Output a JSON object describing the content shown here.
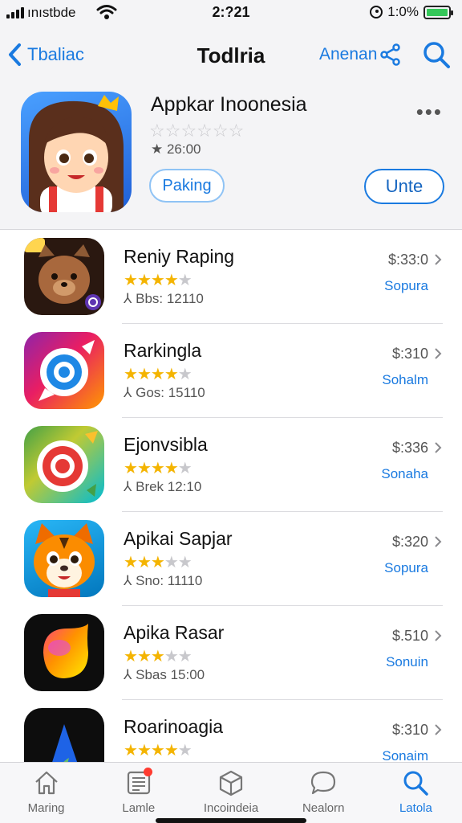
{
  "status_bar": {
    "carrier": "ınıstbde",
    "time": "2:?21",
    "battery": "1:0%",
    "battery_level": 1.0
  },
  "nav": {
    "back_label": "Tbaliac",
    "title": "Todlria",
    "share_label": "Anenan"
  },
  "featured": {
    "title": "Appkar Inoonesia",
    "rating_stars": "☆☆☆☆☆☆",
    "rating_count": "★ 26:00",
    "secondary_button": "Paking",
    "primary_button": "Unte",
    "more_label": "•••"
  },
  "apps": [
    {
      "name": "Reniy Raping",
      "rating": 4,
      "meta": "⅄ Bbs: 12110",
      "price": "$:33:0",
      "action": "Sopura",
      "icon": "bear-face-icon"
    },
    {
      "name": "Rarkingla",
      "rating": 4,
      "meta": "⅄ Gos: 15110",
      "price": "$:310",
      "action": "Sohalm",
      "icon": "chat-ring-icon"
    },
    {
      "name": "Ejonvsibla",
      "rating": 4,
      "meta": "⅄ Brek 12:10",
      "price": "$:336",
      "action": "Sonaha",
      "icon": "target-icon"
    },
    {
      "name": "Apikai Sapjar",
      "rating": 3,
      "meta": "⅄ Sno: 11110",
      "price": "$:320",
      "action": "Sopura",
      "icon": "tiger-face-icon"
    },
    {
      "name": "Apika Rasar",
      "rating": 3,
      "meta": "⅄ Sbas 15:00",
      "price": "$.510",
      "action": "Sonuin",
      "icon": "gradient-blob-icon"
    },
    {
      "name": "Roarinoagia",
      "rating": 4,
      "meta": "",
      "price": "$:310",
      "action": "Sonaim",
      "icon": "leaf-arrow-icon"
    }
  ],
  "tabs": [
    {
      "label": "Maring",
      "icon": "home-icon",
      "active": false
    },
    {
      "label": "Lamle",
      "icon": "news-icon",
      "active": false,
      "badge": true
    },
    {
      "label": "Incoindeia",
      "icon": "box-icon",
      "active": false
    },
    {
      "label": "Nealorn",
      "icon": "chat-icon",
      "active": false
    },
    {
      "label": "Latola",
      "icon": "search-icon",
      "active": true
    }
  ],
  "colors": {
    "accent": "#1a7ae0",
    "star": "#f4b400",
    "battery": "#34c759",
    "badge": "#ff3b30"
  }
}
